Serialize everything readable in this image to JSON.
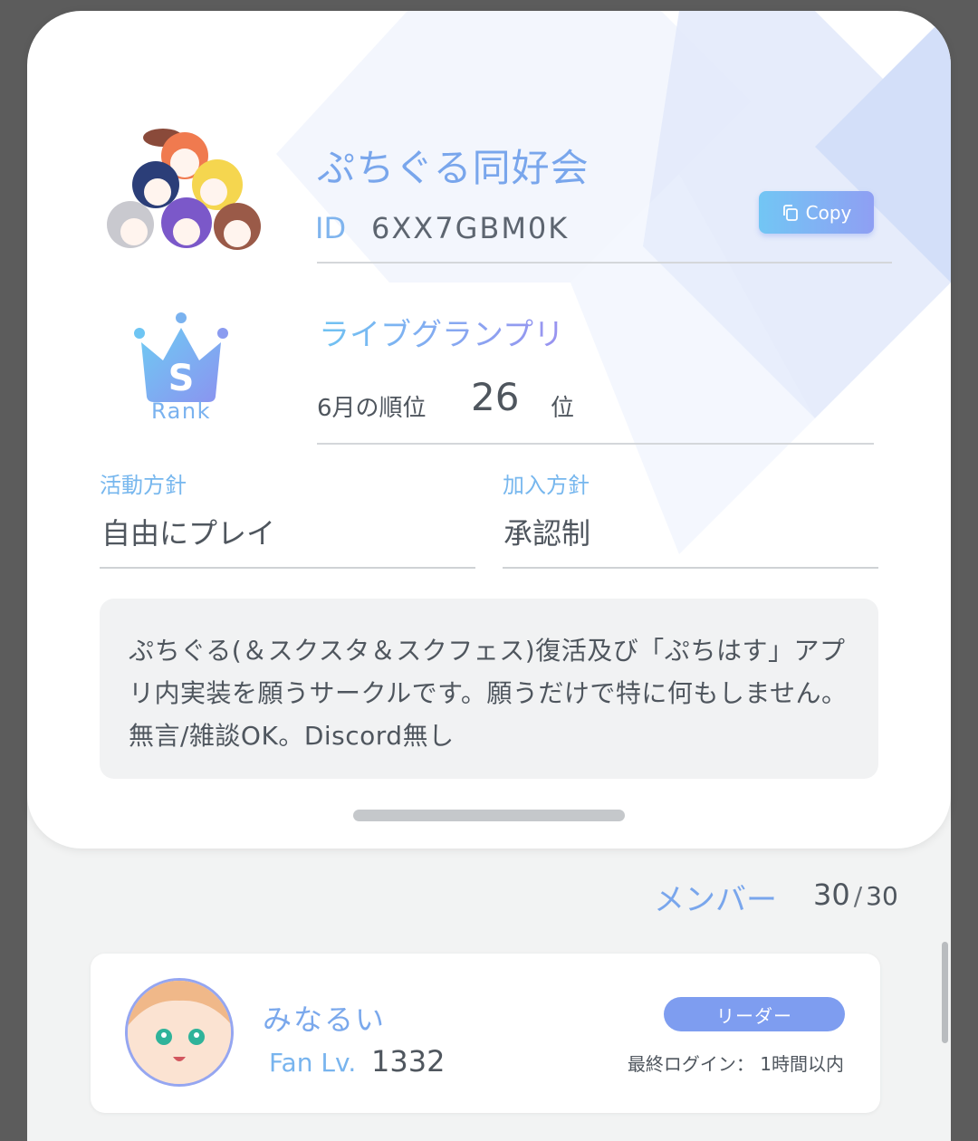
{
  "club": {
    "name": "ぷちぐる同好会",
    "id_label": "ID",
    "id_value": "6XX7GBM0K",
    "copy_label": "Copy"
  },
  "rank": {
    "letter": "S",
    "label": "Rank",
    "title": "ライブグランプリ",
    "month_label": "6月の順位",
    "position": "26",
    "suffix": "位"
  },
  "policies": [
    {
      "label": "活動方針",
      "value": "自由にプレイ"
    },
    {
      "label": "加入方針",
      "value": "承認制"
    }
  ],
  "description": "ぷちぐる(＆スクスタ＆スクフェス)復活及び「ぷちはす」アプリ内実装を願うサークルです。願うだけで特に何もしません。無言/雑談OK。Discord無し",
  "members": {
    "label": "メンバー",
    "count": "30",
    "separator": "/",
    "total": "30",
    "list": [
      {
        "name": "みなるい",
        "fan_label": "Fan Lv.",
        "fan_level": "1332",
        "role": "リーダー",
        "last_login": "最終ログイン： 1時間以内"
      }
    ]
  },
  "colors": {
    "accent_blue": "#79a6ec",
    "accent_cyan": "#7fb4ee",
    "role_badge": "#7e9df0",
    "text_dark": "#4f565e"
  },
  "icons": [
    "copy-icon",
    "crown-icon",
    "club-avatar",
    "member-avatar"
  ]
}
